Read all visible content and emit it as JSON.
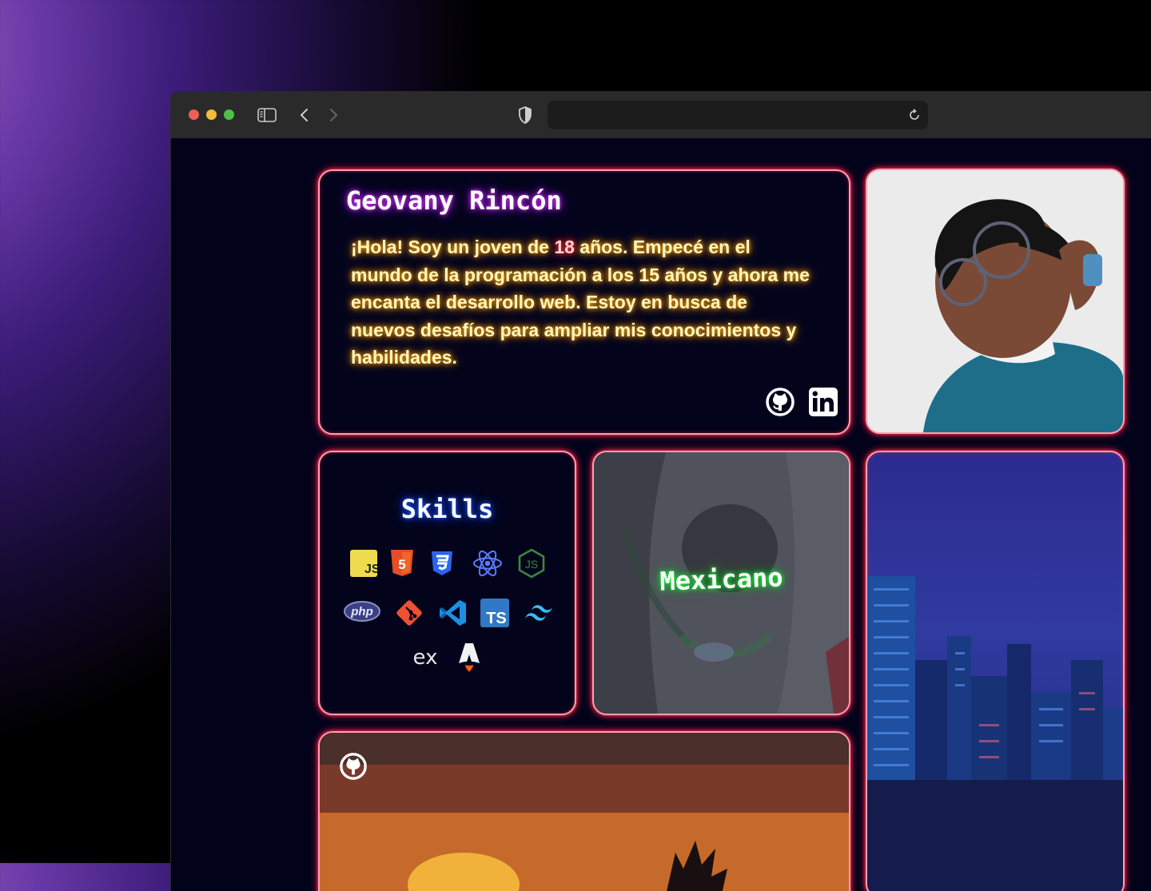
{
  "browser": {
    "address_value": ""
  },
  "intro": {
    "name": "Geovany Rincón",
    "bio_part1": "¡Hola! Soy un joven de ",
    "bio_age": "18",
    "bio_part2": " años. Empecé en el mundo de la programación a los 15 años y ahora me encanta el desarrollo web. Estoy en busca de nuevos desafíos para ampliar mis conocimientos y habilidades.",
    "social": [
      "github-icon",
      "linkedin-icon"
    ]
  },
  "skills": {
    "title": "Skills",
    "icons": [
      "javascript-icon",
      "html5-icon",
      "css3-icon",
      "react-icon",
      "nodejs-icon",
      "php-icon",
      "git-icon",
      "vscode-icon",
      "typescript-icon",
      "tailwind-icon",
      "express-icon",
      "astro-icon"
    ]
  },
  "nationality": {
    "label": "Mexicano"
  },
  "colors": {
    "card_border": "#ff9fae",
    "card_glow": "#ff1744",
    "name_glow": "#b000ff",
    "bio_glow": "#ff8a00",
    "skills_glow": "#0040ff",
    "mexico_glow": "#00c81e"
  }
}
